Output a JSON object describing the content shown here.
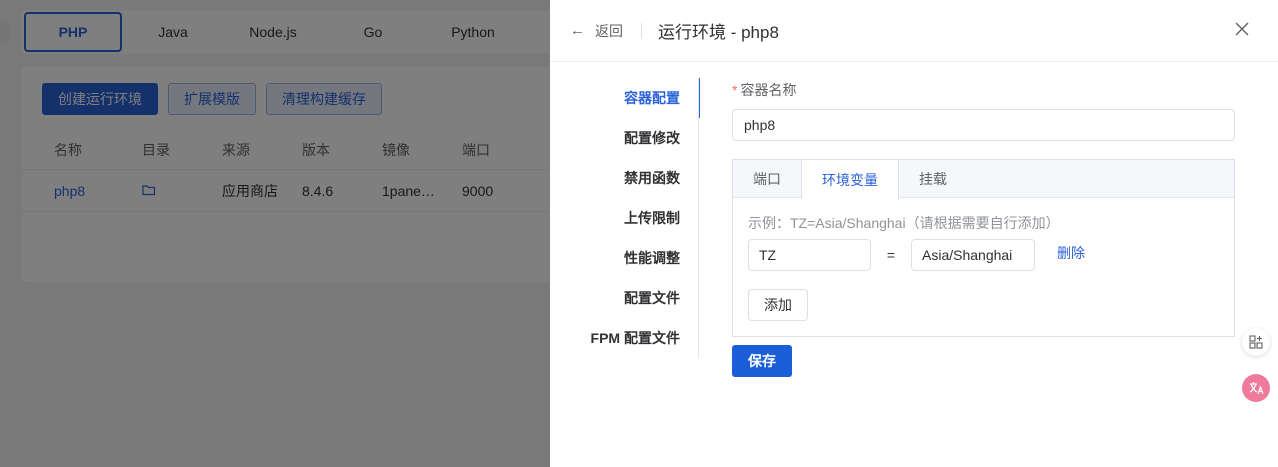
{
  "background": {
    "tabs": [
      "PHP",
      "Java",
      "Node.js",
      "Go",
      "Python"
    ],
    "active_tab": "PHP",
    "buttons": {
      "create": "创建运行环境",
      "extensions": "扩展模版",
      "clear_cache": "清理构建缓存"
    },
    "table": {
      "headers": [
        "名称",
        "目录",
        "来源",
        "版本",
        "镜像",
        "端口"
      ],
      "rows": [
        {
          "name": "php8",
          "source": "应用商店",
          "version": "8.4.6",
          "image": "1pane…",
          "port": "9000"
        }
      ]
    }
  },
  "drawer": {
    "back_label": "返回",
    "title": "运行环境 - php8",
    "menu": [
      "容器配置",
      "配置修改",
      "禁用函数",
      "上传限制",
      "性能调整",
      "配置文件",
      "FPM 配置文件"
    ],
    "active_menu": "容器配置",
    "form": {
      "container_name_label": "容器名称",
      "container_name_value": "php8",
      "tabs": [
        "端口",
        "环境变量",
        "挂载"
      ],
      "active_tab": "环境变量",
      "hint": "示例：TZ=Asia/Shanghai（请根据需要自行添加）",
      "env": {
        "key": "TZ",
        "equals": "=",
        "value": "Asia/Shanghai",
        "delete_label": "删除"
      },
      "add_label": "添加",
      "save_label": "保存"
    }
  },
  "colors": {
    "primary": "#2b63d9",
    "required": "#f56c6c",
    "overlay": "rgba(0,0,0,0.5)"
  },
  "icons": [
    "folder-icon",
    "back-arrow-icon",
    "close-icon",
    "apps-add-icon",
    "translate-icon"
  ]
}
